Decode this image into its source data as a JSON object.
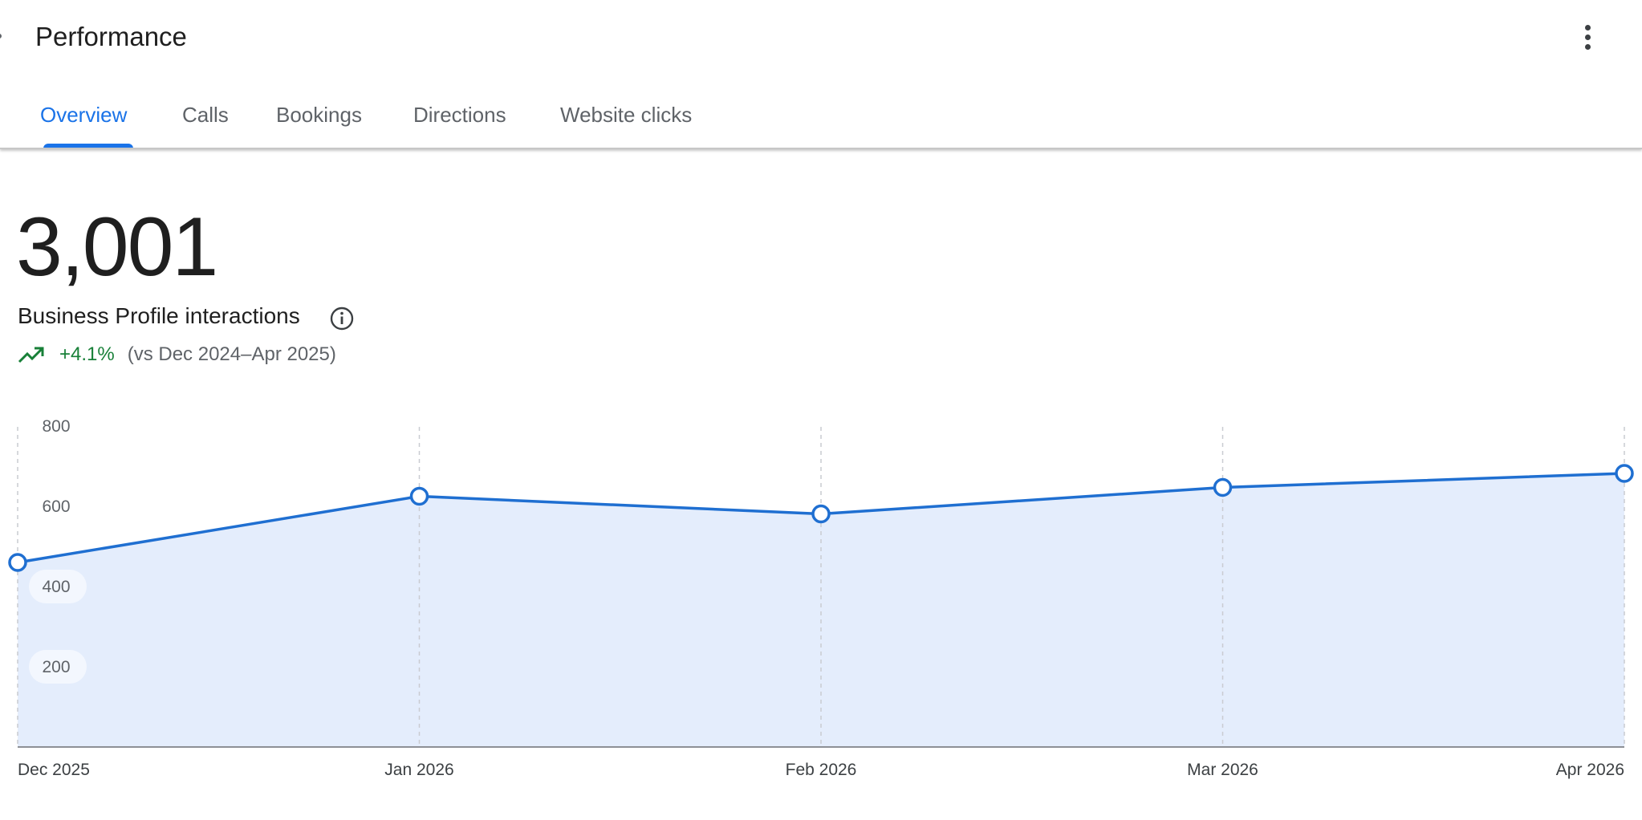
{
  "header": {
    "title": "Performance",
    "more_icon": "more-vert-icon"
  },
  "tabs": [
    {
      "label": "Overview",
      "active": true
    },
    {
      "label": "Calls",
      "active": false
    },
    {
      "label": "Bookings",
      "active": false
    },
    {
      "label": "Directions",
      "active": false
    },
    {
      "label": "Website clicks",
      "active": false
    }
  ],
  "summary": {
    "value": "3,001",
    "label": "Business Profile interactions",
    "info_icon": "info-icon",
    "trend_icon": "trending-up-icon",
    "change": "+4.1%",
    "comparison": "(vs Dec 2024–Apr 2025)"
  },
  "colors": {
    "accent": "#1a73e8",
    "line": "#1f6fd1",
    "area_fill": "#e4edfc",
    "positive": "#188038"
  },
  "chart_data": {
    "type": "area",
    "x": [
      "Dec 2025",
      "Jan 2026",
      "Feb 2026",
      "Mar 2026",
      "Apr 2026"
    ],
    "series": [
      {
        "values": [
          460,
          625,
          581,
          647,
          682
        ]
      }
    ],
    "yticks": [
      200,
      400,
      600,
      800
    ],
    "ylim": [
      0,
      800
    ],
    "grid": "vertical-dashed"
  }
}
